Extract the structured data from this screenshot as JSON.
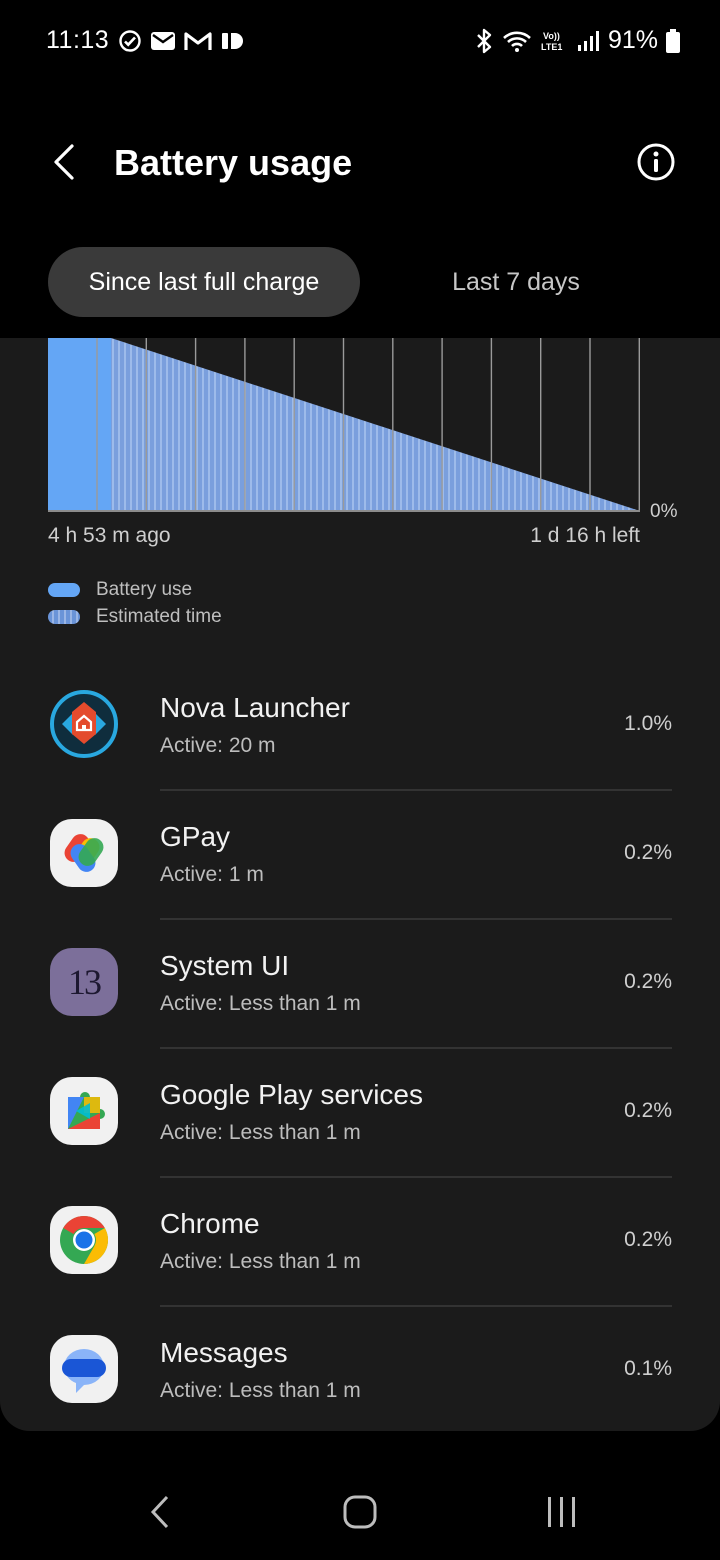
{
  "status_bar": {
    "time": "11:13",
    "battery_pct": "91%",
    "volte": "Vo)) LTE1"
  },
  "header": {
    "title": "Battery usage"
  },
  "tabs": [
    {
      "label": "Since last full charge",
      "active": true
    },
    {
      "label": "Last 7 days",
      "active": false
    }
  ],
  "chart": {
    "zero_label": "0%",
    "start_label": "4 h 53 m ago",
    "end_label": "1 d 16 h left"
  },
  "chart_data": {
    "type": "area",
    "series": [
      {
        "name": "Battery use",
        "color": "#64a6f5"
      },
      {
        "name": "Estimated time",
        "color": "#7ea3e2"
      }
    ],
    "x_labels": [
      "4 h 53 m ago",
      "1 d 16 h left"
    ],
    "y_label": "0%"
  },
  "legend": [
    {
      "label": "Battery use",
      "style": "solid"
    },
    {
      "label": "Estimated time",
      "style": "striped"
    }
  ],
  "apps": [
    {
      "name": "Nova Launcher",
      "active": "Active: 20 m",
      "pct": "1.0%",
      "icon": "nova-launcher-icon"
    },
    {
      "name": "GPay",
      "active": "Active: 1 m",
      "pct": "0.2%",
      "icon": "gpay-icon"
    },
    {
      "name": "System UI",
      "active": "Active: Less than 1 m",
      "pct": "0.2%",
      "icon": "system-ui-icon",
      "icon_text": "13"
    },
    {
      "name": "Google Play services",
      "active": "Active: Less than 1 m",
      "pct": "0.2%",
      "icon": "google-play-services-icon"
    },
    {
      "name": "Chrome",
      "active": "Active: Less than 1 m",
      "pct": "0.2%",
      "icon": "chrome-icon"
    },
    {
      "name": "Messages",
      "active": "Active: Less than 1 m",
      "pct": "0.1%",
      "icon": "messages-icon"
    }
  ],
  "colors": {
    "accent": "#64a6f5",
    "card_bg": "#1b1b1b",
    "tab_active_bg": "#3a3a3a"
  }
}
